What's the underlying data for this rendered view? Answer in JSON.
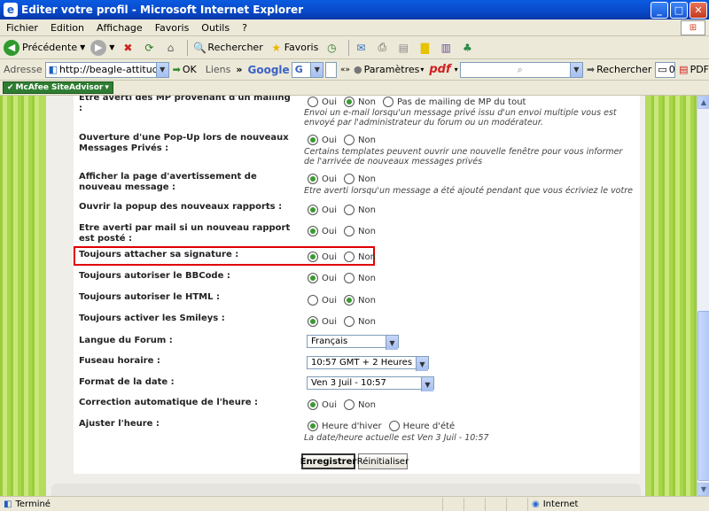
{
  "window": {
    "title": "Editer votre profil - Microsoft Internet Explorer"
  },
  "menu": [
    "Fichier",
    "Edition",
    "Affichage",
    "Favoris",
    "Outils",
    "?"
  ],
  "toolbar": {
    "back": "Précédente",
    "search": "Rechercher",
    "favorites": "Favoris"
  },
  "address": {
    "label": "Adresse",
    "url": "http://beagle-attitude.forum",
    "go": "OK",
    "links": "Liens",
    "google": "Google",
    "gbox": "G",
    "params": "Paramètres",
    "pdf": "pdf",
    "search2": "Rechercher",
    "count": "0",
    "pdf2": "PDF"
  },
  "mcafee": {
    "label": "McAfee SiteAdvisor"
  },
  "form": {
    "rows": [
      {
        "label": "Être averti des MP provenant d'un mailing :",
        "opts": [
          "Oui",
          "Non",
          "Pas de mailing de MP du tout"
        ],
        "checked": 1,
        "help": "Envoi un e-mail lorsqu'un message privé issu d'un envoi multiple vous est envoyé par l'administrateur du forum ou un modérateur."
      },
      {
        "label": "Ouverture d'une Pop-Up lors de nouveaux Messages Privés :",
        "opts": [
          "Oui",
          "Non"
        ],
        "checked": 0,
        "help": "Certains templates peuvent ouvrir une nouvelle fenêtre pour vous informer de l'arrivée de nouveaux messages privés"
      },
      {
        "label": "Afficher la page d'avertissement de nouveau message :",
        "opts": [
          "Oui",
          "Non"
        ],
        "checked": 0,
        "help": "Etre averti lorsqu'un message a été ajouté pendant que vous écriviez le votre"
      },
      {
        "label": "Ouvrir la popup des nouveaux rapports :",
        "opts": [
          "Oui",
          "Non"
        ],
        "checked": 0,
        "help": ""
      },
      {
        "label": "Etre averti par mail si un nouveau rapport est posté :",
        "opts": [
          "Oui",
          "Non"
        ],
        "checked": 0,
        "help": ""
      },
      {
        "label": "Toujours attacher sa signature :",
        "opts": [
          "Oui",
          "Non"
        ],
        "checked": 0,
        "help": ""
      },
      {
        "label": "Toujours autoriser le BBCode :",
        "opts": [
          "Oui",
          "Non"
        ],
        "checked": 0,
        "help": ""
      },
      {
        "label": "Toujours autoriser le HTML :",
        "opts": [
          "Oui",
          "Non"
        ],
        "checked": 1,
        "help": ""
      },
      {
        "label": "Toujours activer les Smileys :",
        "opts": [
          "Oui",
          "Non"
        ],
        "checked": 0,
        "help": ""
      }
    ],
    "langue": {
      "label": "Langue du Forum :",
      "value": "Français"
    },
    "fuseau": {
      "label": "Fuseau horaire :",
      "value": "10:57 GMT + 2 Heures"
    },
    "format": {
      "label": "Format de la date :",
      "value": "Ven 3 Juil - 10:57"
    },
    "correction": {
      "label": "Correction automatique de l'heure :",
      "opts": [
        "Oui",
        "Non"
      ],
      "checked": 0
    },
    "ajuster": {
      "label": "Ajuster l'heure :",
      "opts": [
        "Heure d'hiver",
        "Heure d'été"
      ],
      "checked": 0,
      "help": "La date/heure actuelle est Ven 3 Juil - 10:57"
    },
    "buttons": {
      "save": "Enregistrer",
      "reset": "Réinitialiser"
    }
  },
  "status": {
    "left": "Terminé",
    "zone": "Internet"
  },
  "colors": {
    "highlight": "#e00000",
    "radio_checked": "#3a9a30",
    "bg_green": "#b5dc5f"
  }
}
